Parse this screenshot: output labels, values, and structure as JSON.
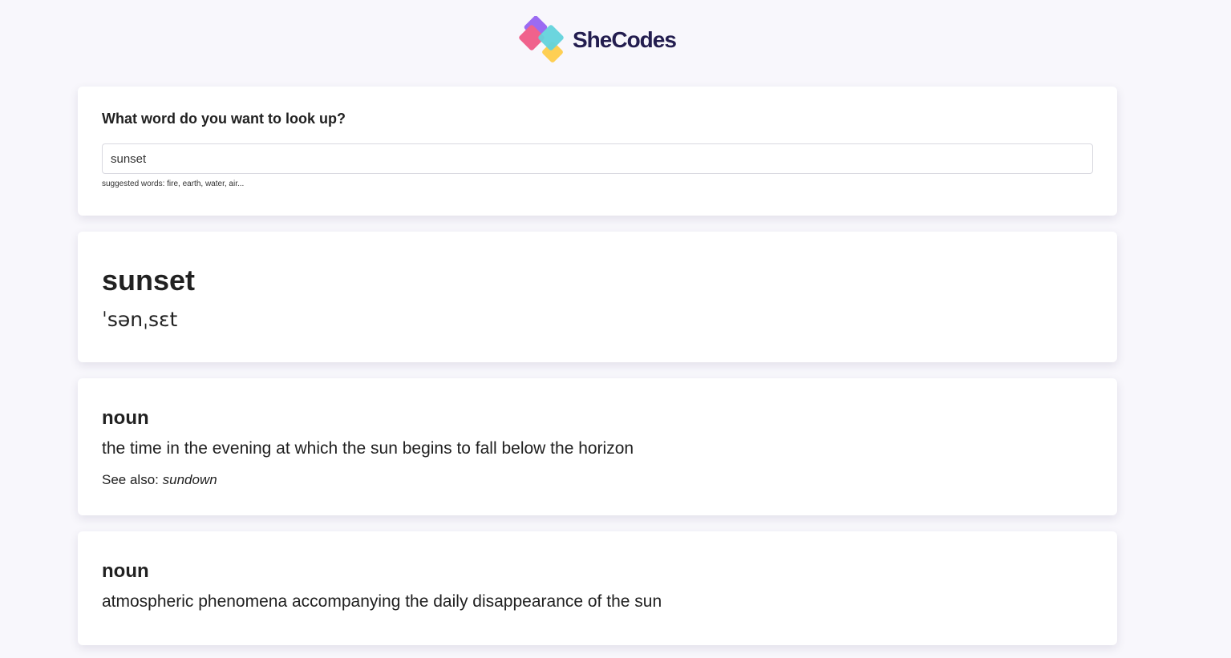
{
  "brand": {
    "name": "SheCodes",
    "colors": {
      "purple": "#9b6bf2",
      "pink": "#f0628c",
      "teal": "#63d3dc",
      "yellow": "#fecf53",
      "text": "#231d4f"
    }
  },
  "search": {
    "label": "What word do you want to look up?",
    "value": "sunset",
    "hint": "suggested words: fire, earth, water, air..."
  },
  "word": {
    "title": "sunset",
    "phonetic": "ˈsənˌsɛt"
  },
  "meanings": [
    {
      "part_of_speech": "noun",
      "definition": "the time in the evening at which the sun begins to fall below the horizon",
      "see_also_label": "See also:",
      "see_also_word": "sundown"
    },
    {
      "part_of_speech": "noun",
      "definition": "atmospheric phenomena accompanying the daily disappearance of the sun"
    }
  ]
}
